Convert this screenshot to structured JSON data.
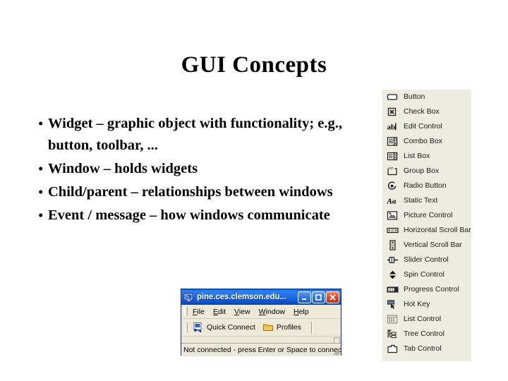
{
  "slide": {
    "title": "GUI Concepts",
    "bullet_marker": "•",
    "bullets": [
      "Widget – graphic object with functionality; e.g., button, toolbar, ...",
      "Window – holds widgets",
      "Child/parent – relationships between windows",
      "Event / message – how windows communicate"
    ]
  },
  "toolbox": {
    "background_color": "#ecece0",
    "items": [
      {
        "label": "Button",
        "icon": "button-icon"
      },
      {
        "label": "Check Box",
        "icon": "check-box-icon"
      },
      {
        "label": "Edit Control",
        "icon": "edit-control-icon"
      },
      {
        "label": "Combo Box",
        "icon": "combo-box-icon"
      },
      {
        "label": "List Box",
        "icon": "list-box-icon"
      },
      {
        "label": "Group Box",
        "icon": "group-box-icon"
      },
      {
        "label": "Radio Button",
        "icon": "radio-button-icon"
      },
      {
        "label": "Static Text",
        "icon": "static-text-icon"
      },
      {
        "label": "Picture Control",
        "icon": "picture-control-icon"
      },
      {
        "label": "Horizontal Scroll Bar",
        "icon": "horizontal-scroll-bar-icon"
      },
      {
        "label": "Vertical Scroll Bar",
        "icon": "vertical-scroll-bar-icon"
      },
      {
        "label": "Slider Control",
        "icon": "slider-control-icon"
      },
      {
        "label": "Spin Control",
        "icon": "spin-control-icon"
      },
      {
        "label": "Progress Control",
        "icon": "progress-control-icon"
      },
      {
        "label": "Hot Key",
        "icon": "hot-key-icon"
      },
      {
        "label": "List Control",
        "icon": "list-control-icon"
      },
      {
        "label": "Tree Control",
        "icon": "tree-control-icon"
      },
      {
        "label": "Tab Control",
        "icon": "tab-control-icon"
      }
    ]
  },
  "xp_window": {
    "title": "pine.ces.clemson.edu...",
    "titlebar_color": "#1f6fe8",
    "close_button_color": "#e24a28",
    "caption_buttons": {
      "minimize": "minimize-button",
      "maximize": "maximize-button",
      "close": "close-button"
    },
    "menu": [
      {
        "label": "File",
        "accel": "F"
      },
      {
        "label": "Edit",
        "accel": "E"
      },
      {
        "label": "View",
        "accel": "V"
      },
      {
        "label": "Window",
        "accel": "W"
      },
      {
        "label": "Help",
        "accel": "H"
      }
    ],
    "toolbar": [
      {
        "label": "Quick Connect",
        "icon": "quick-connect-icon"
      },
      {
        "label": "Profiles",
        "icon": "folder-icon"
      }
    ],
    "status": "Not connected - press Enter or Space to connec"
  }
}
